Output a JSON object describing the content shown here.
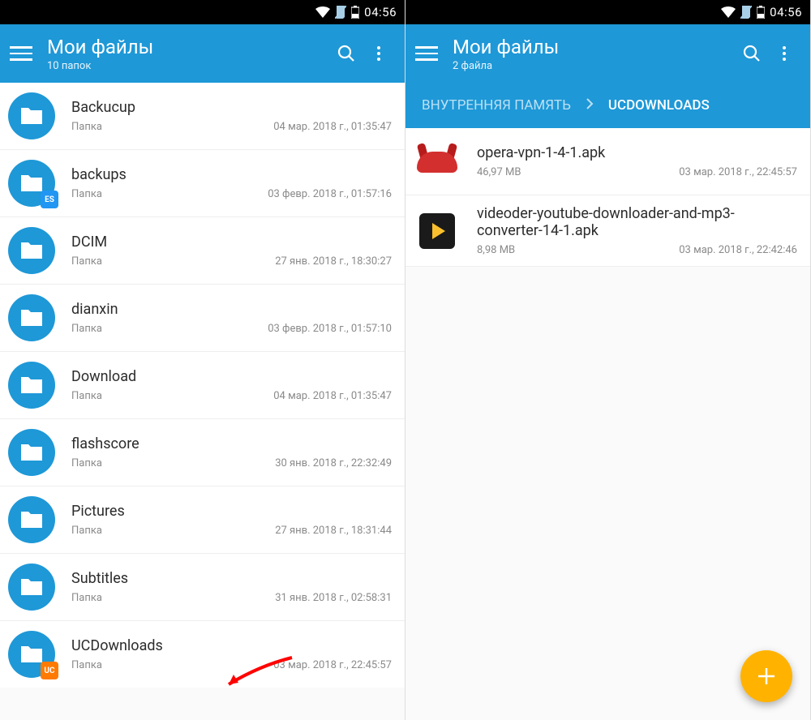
{
  "status": {
    "time": "04:56"
  },
  "left": {
    "title": "Мои файлы",
    "subtitle": "10 папок",
    "folders": [
      {
        "name": "Backucup",
        "type": "Папка",
        "date": "04 мар. 2018 г., 01:35:47",
        "badge": null
      },
      {
        "name": "backups",
        "type": "Папка",
        "date": "03 февр. 2018 г., 01:57:16",
        "badge": "es"
      },
      {
        "name": "DCIM",
        "type": "Папка",
        "date": "27 янв. 2018 г., 18:30:27",
        "badge": null
      },
      {
        "name": "dianxin",
        "type": "Папка",
        "date": "03 февр. 2018 г., 01:57:10",
        "badge": null
      },
      {
        "name": "Download",
        "type": "Папка",
        "date": "04 мар. 2018 г., 01:35:47",
        "badge": null
      },
      {
        "name": "flashscore",
        "type": "Папка",
        "date": "30 янв. 2018 г., 22:32:49",
        "badge": null
      },
      {
        "name": "Pictures",
        "type": "Папка",
        "date": "27 янв. 2018 г., 18:31:44",
        "badge": null
      },
      {
        "name": "Subtitles",
        "type": "Папка",
        "date": "31 янв. 2018 г., 02:58:31",
        "badge": null
      },
      {
        "name": "UCDownloads",
        "type": "Папка",
        "date": "03 мар. 2018 г., 22:45:57",
        "badge": "uc"
      }
    ]
  },
  "right": {
    "title": "Мои файлы",
    "subtitle": "2 файла",
    "breadcrumb": {
      "parent": "ВНУТРЕННЯЯ ПАМЯТЬ",
      "current": "UCDOWNLOADS"
    },
    "files": [
      {
        "name": "opera-vpn-1-4-1.apk",
        "size": "46,97 MB",
        "date": "03 мар. 2018 г., 22:45:57",
        "icon": "opera"
      },
      {
        "name": "videoder-youtube-downloader-and-mp3-converter-14-1.apk",
        "size": "8,98 MB",
        "date": "03 мар. 2018 г., 22:42:46",
        "icon": "videoder"
      }
    ]
  }
}
